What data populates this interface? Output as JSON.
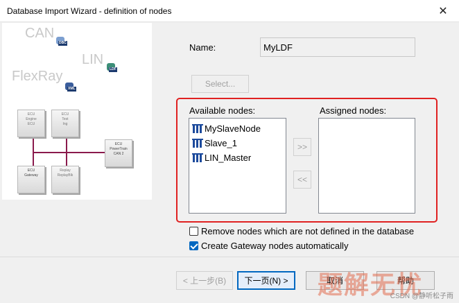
{
  "window": {
    "title": "Database Import Wizard - definition of nodes"
  },
  "illustration": {
    "protocols": [
      "CAN",
      "LIN",
      "FlexRay"
    ],
    "db_tags": [
      "DBC",
      "LDF",
      "XML"
    ],
    "ecus": [
      {
        "line1": "ECU",
        "line2": "Engine",
        "line3": "ECU"
      },
      {
        "line1": "ECU",
        "line2": "Test",
        "line3": "Ing"
      },
      {
        "line1": "ECU",
        "line2": "PowerTrain",
        "line3": "CAN 2"
      },
      {
        "line1": "ECU",
        "line2": "Gateway",
        "line3": ""
      },
      {
        "line1": "Replay",
        "line2": "ReplayBlk",
        "line3": ""
      }
    ]
  },
  "form": {
    "name_label": "Name:",
    "name_value": "MyLDF",
    "select_button": "Select..."
  },
  "available": {
    "label": "Available nodes:",
    "items": [
      "MySlaveNode",
      "Slave_1",
      "LIN_Master"
    ]
  },
  "assigned": {
    "label": "Assigned nodes:",
    "items": []
  },
  "transfer": {
    "add": ">>",
    "remove": "<<"
  },
  "options": {
    "remove_nodes": {
      "label": "Remove nodes which are not defined in the database",
      "checked": false
    },
    "create_gateway": {
      "label": "Create Gateway nodes automatically",
      "checked": true
    }
  },
  "footer": {
    "back": "< 上一步(B)",
    "next": "下一页(N) >",
    "cancel": "取消",
    "help": "帮助"
  },
  "overlay": {
    "watermark": "题解无忧",
    "credit": "CSDN @静听松子雨"
  },
  "colors": {
    "highlight": "#e02020",
    "bus": "#8a1a4c",
    "checkbox": "#0067c0"
  }
}
